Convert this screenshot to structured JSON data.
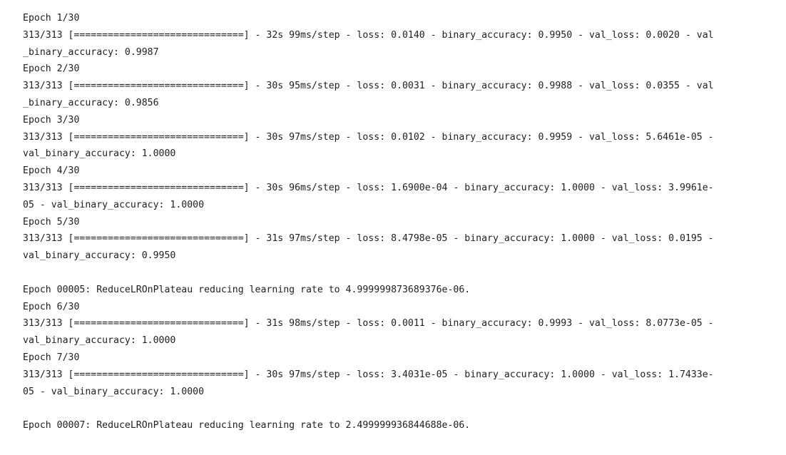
{
  "output": {
    "lines": [
      "Epoch 1/30",
      "313/313 [==============================] - 32s 99ms/step - loss: 0.0140 - binary_accuracy: 0.9950 - val_loss: 0.0020 - val",
      "_binary_accuracy: 0.9987",
      "Epoch 2/30",
      "313/313 [==============================] - 30s 95ms/step - loss: 0.0031 - binary_accuracy: 0.9988 - val_loss: 0.0355 - val",
      "_binary_accuracy: 0.9856",
      "Epoch 3/30",
      "313/313 [==============================] - 30s 97ms/step - loss: 0.0102 - binary_accuracy: 0.9959 - val_loss: 5.6461e-05 -",
      "val_binary_accuracy: 1.0000",
      "Epoch 4/30",
      "313/313 [==============================] - 30s 96ms/step - loss: 1.6900e-04 - binary_accuracy: 1.0000 - val_loss: 3.9961e-",
      "05 - val_binary_accuracy: 1.0000",
      "Epoch 5/30",
      "313/313 [==============================] - 31s 97ms/step - loss: 8.4798e-05 - binary_accuracy: 1.0000 - val_loss: 0.0195 -",
      "val_binary_accuracy: 0.9950",
      "",
      "Epoch 00005: ReduceLROnPlateau reducing learning rate to 4.999999873689376e-06.",
      "Epoch 6/30",
      "313/313 [==============================] - 31s 98ms/step - loss: 0.0011 - binary_accuracy: 0.9993 - val_loss: 8.0773e-05 -",
      "val_binary_accuracy: 1.0000",
      "Epoch 7/30",
      "313/313 [==============================] - 30s 97ms/step - loss: 3.4031e-05 - binary_accuracy: 1.0000 - val_loss: 1.7433e-",
      "05 - val_binary_accuracy: 1.0000",
      "",
      "Epoch 00007: ReduceLROnPlateau reducing learning rate to 2.499999936844688e-06."
    ]
  }
}
